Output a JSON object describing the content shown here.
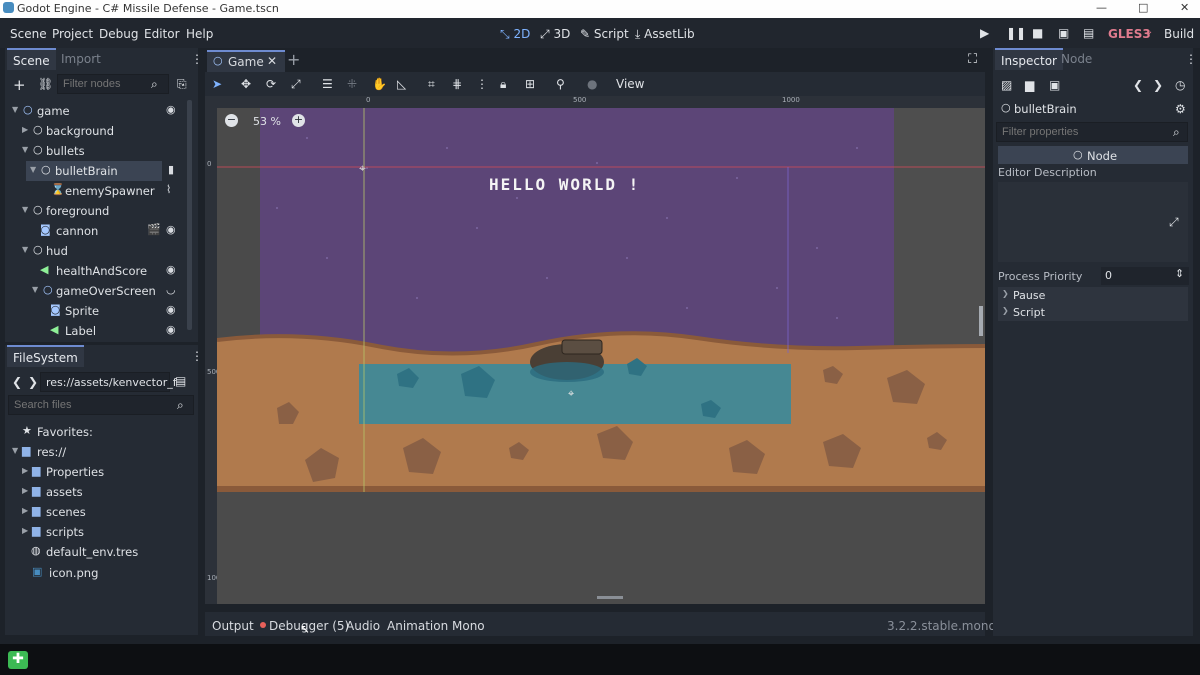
{
  "window": {
    "title": "Godot Engine - C# Missile Defense - Game.tscn",
    "minimize": "—",
    "maximize": "□",
    "close": "✕"
  },
  "menu": {
    "items": [
      "Scene",
      "Project",
      "Debug",
      "Editor",
      "Help"
    ],
    "modes": [
      "2D",
      "3D",
      "Script",
      "AssetLib"
    ],
    "renderer": "GLES3",
    "build": "Build"
  },
  "scene_dock": {
    "tabs": [
      "Scene",
      "Import"
    ],
    "filter_placeholder": "Filter nodes",
    "nodes": [
      {
        "label": "game",
        "right": "◉"
      },
      {
        "label": "background",
        "right": ""
      },
      {
        "label": "bullets",
        "right": ""
      },
      {
        "label": "bulletBrain",
        "right": "▮"
      },
      {
        "label": "enemySpawner",
        "right": "⌇"
      },
      {
        "label": "foreground",
        "right": ""
      },
      {
        "label": "cannon",
        "right": "◉"
      },
      {
        "label": "hud",
        "right": ""
      },
      {
        "label": "healthAndScore",
        "right": "◉"
      },
      {
        "label": "gameOverScreen",
        "right": "◡"
      },
      {
        "label": "Sprite",
        "right": "◉"
      },
      {
        "label": "Label",
        "right": "◉"
      }
    ]
  },
  "filesystem": {
    "tab": "FileSystem",
    "path": "res://assets/kenvector_f",
    "search_placeholder": "Search files",
    "items": [
      {
        "label": "Favorites:"
      },
      {
        "label": "res://"
      },
      {
        "label": "Properties"
      },
      {
        "label": "assets"
      },
      {
        "label": "scenes"
      },
      {
        "label": "scripts"
      },
      {
        "label": "default_env.tres"
      },
      {
        "label": "icon.png"
      }
    ]
  },
  "editor": {
    "tab": "Game",
    "toolbar_view": "View",
    "zoom": "53 %",
    "ruler_labels": [
      "0",
      "500",
      "1000"
    ],
    "ruler_v_labels": [
      "0",
      "500",
      "1000"
    ],
    "game_text": "HELLO WORLD !"
  },
  "bottom_panel": {
    "tabs": [
      "Output",
      "Debugger (5)",
      "Audio",
      "Animation",
      "Mono"
    ],
    "version": "3.2.2.stable.mono"
  },
  "inspector": {
    "tabs": [
      "Inspector",
      "Node"
    ],
    "node_name": "bulletBrain",
    "filter_placeholder": "Filter properties",
    "class_name": "Node",
    "editor_description_label": "Editor Description",
    "process_priority_label": "Process Priority",
    "process_priority_value": "0",
    "sections": [
      "Pause",
      "Script"
    ]
  },
  "colors": {
    "sky": "#5c4577",
    "ground": "#b07a4d",
    "water": "#3b8a9b",
    "accent": "#6e8bd0",
    "gles": "#e07b8e"
  }
}
